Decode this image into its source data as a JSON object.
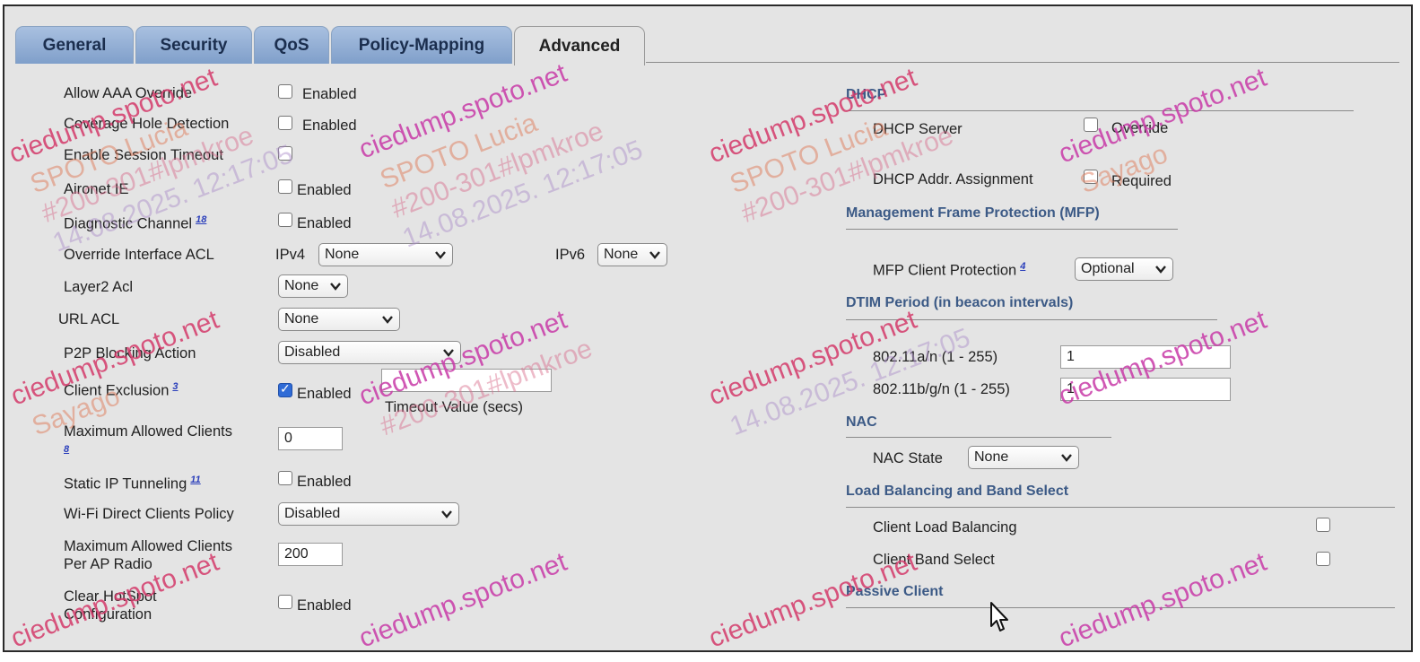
{
  "tabs": [
    {
      "label": "General"
    },
    {
      "label": "Security"
    },
    {
      "label": "QoS"
    },
    {
      "label": "Policy-Mapping"
    },
    {
      "label": "Advanced"
    }
  ],
  "left": {
    "allow_aaa": {
      "label": "Allow AAA Override",
      "enabled_text": "Enabled"
    },
    "coverage_hole": {
      "label": "Coverage Hole Detection",
      "enabled_text": "Enabled"
    },
    "session_timeout": {
      "label": "Enable Session Timeout"
    },
    "aironet_ie": {
      "label": "Aironet IE",
      "enabled_text": "Enabled"
    },
    "diagnostic_channel": {
      "label": "Diagnostic Channel",
      "footnote": "18",
      "enabled_text": "Enabled"
    },
    "override_acl": {
      "label": "Override Interface ACL",
      "ipv4_label": "IPv4",
      "ipv4_value": "None",
      "ipv6_label": "IPv6",
      "ipv6_value": "None"
    },
    "layer2_acl": {
      "label": "Layer2 Acl",
      "value": "None"
    },
    "url_acl": {
      "label": "URL ACL",
      "value": "None"
    },
    "p2p_blocking": {
      "label": "P2P Blocking Action",
      "value": "Disabled"
    },
    "client_exclusion": {
      "label": "Client Exclusion",
      "footnote": "3",
      "enabled_text": "Enabled",
      "timeout_label": "Timeout Value (secs)",
      "timeout_value": ""
    },
    "max_clients": {
      "label_line1": "Maximum Allowed Clients",
      "footnote": "8",
      "value": "0"
    },
    "static_ip": {
      "label": "Static IP Tunneling",
      "footnote": "11",
      "enabled_text": "Enabled"
    },
    "wifi_direct": {
      "label": "Wi-Fi Direct Clients Policy",
      "value": "Disabled"
    },
    "max_clients_radio": {
      "label_line1": "Maximum Allowed Clients",
      "label_line2": "Per AP Radio",
      "value": "200"
    },
    "clear_hotspot": {
      "label_line1": "Clear HotSpot",
      "label_line2": "Configuration",
      "enabled_text": "Enabled"
    }
  },
  "right": {
    "dhcp": {
      "title": "DHCP",
      "server_label": "DHCP Server",
      "server_option": "Override",
      "assign_label": "DHCP Addr. Assignment",
      "assign_option": "Required"
    },
    "mfp": {
      "title": "Management Frame Protection (MFP)",
      "client_label": "MFP Client Protection",
      "footnote": "4",
      "value": "Optional"
    },
    "dtim": {
      "title": "DTIM Period (in beacon intervals)",
      "a_label": "802.11a/n (1 - 255)",
      "a_value": "1",
      "b_label": "802.11b/g/n (1 - 255)",
      "b_value": "1"
    },
    "nac": {
      "title": "NAC",
      "state_label": "NAC State",
      "state_value": "None"
    },
    "lb": {
      "title": "Load Balancing and Band Select",
      "load_label": "Client Load Balancing",
      "band_label": "Client Band Select"
    },
    "passive": {
      "title": "Passive Client"
    }
  },
  "watermark": {
    "site": "ciedump.spoto.net",
    "line1": "SPOTO Lucia",
    "line2": "#200-301#lpmkroe",
    "line3": "14.08.2025. 12:17:05",
    "line4": "Sayago"
  }
}
